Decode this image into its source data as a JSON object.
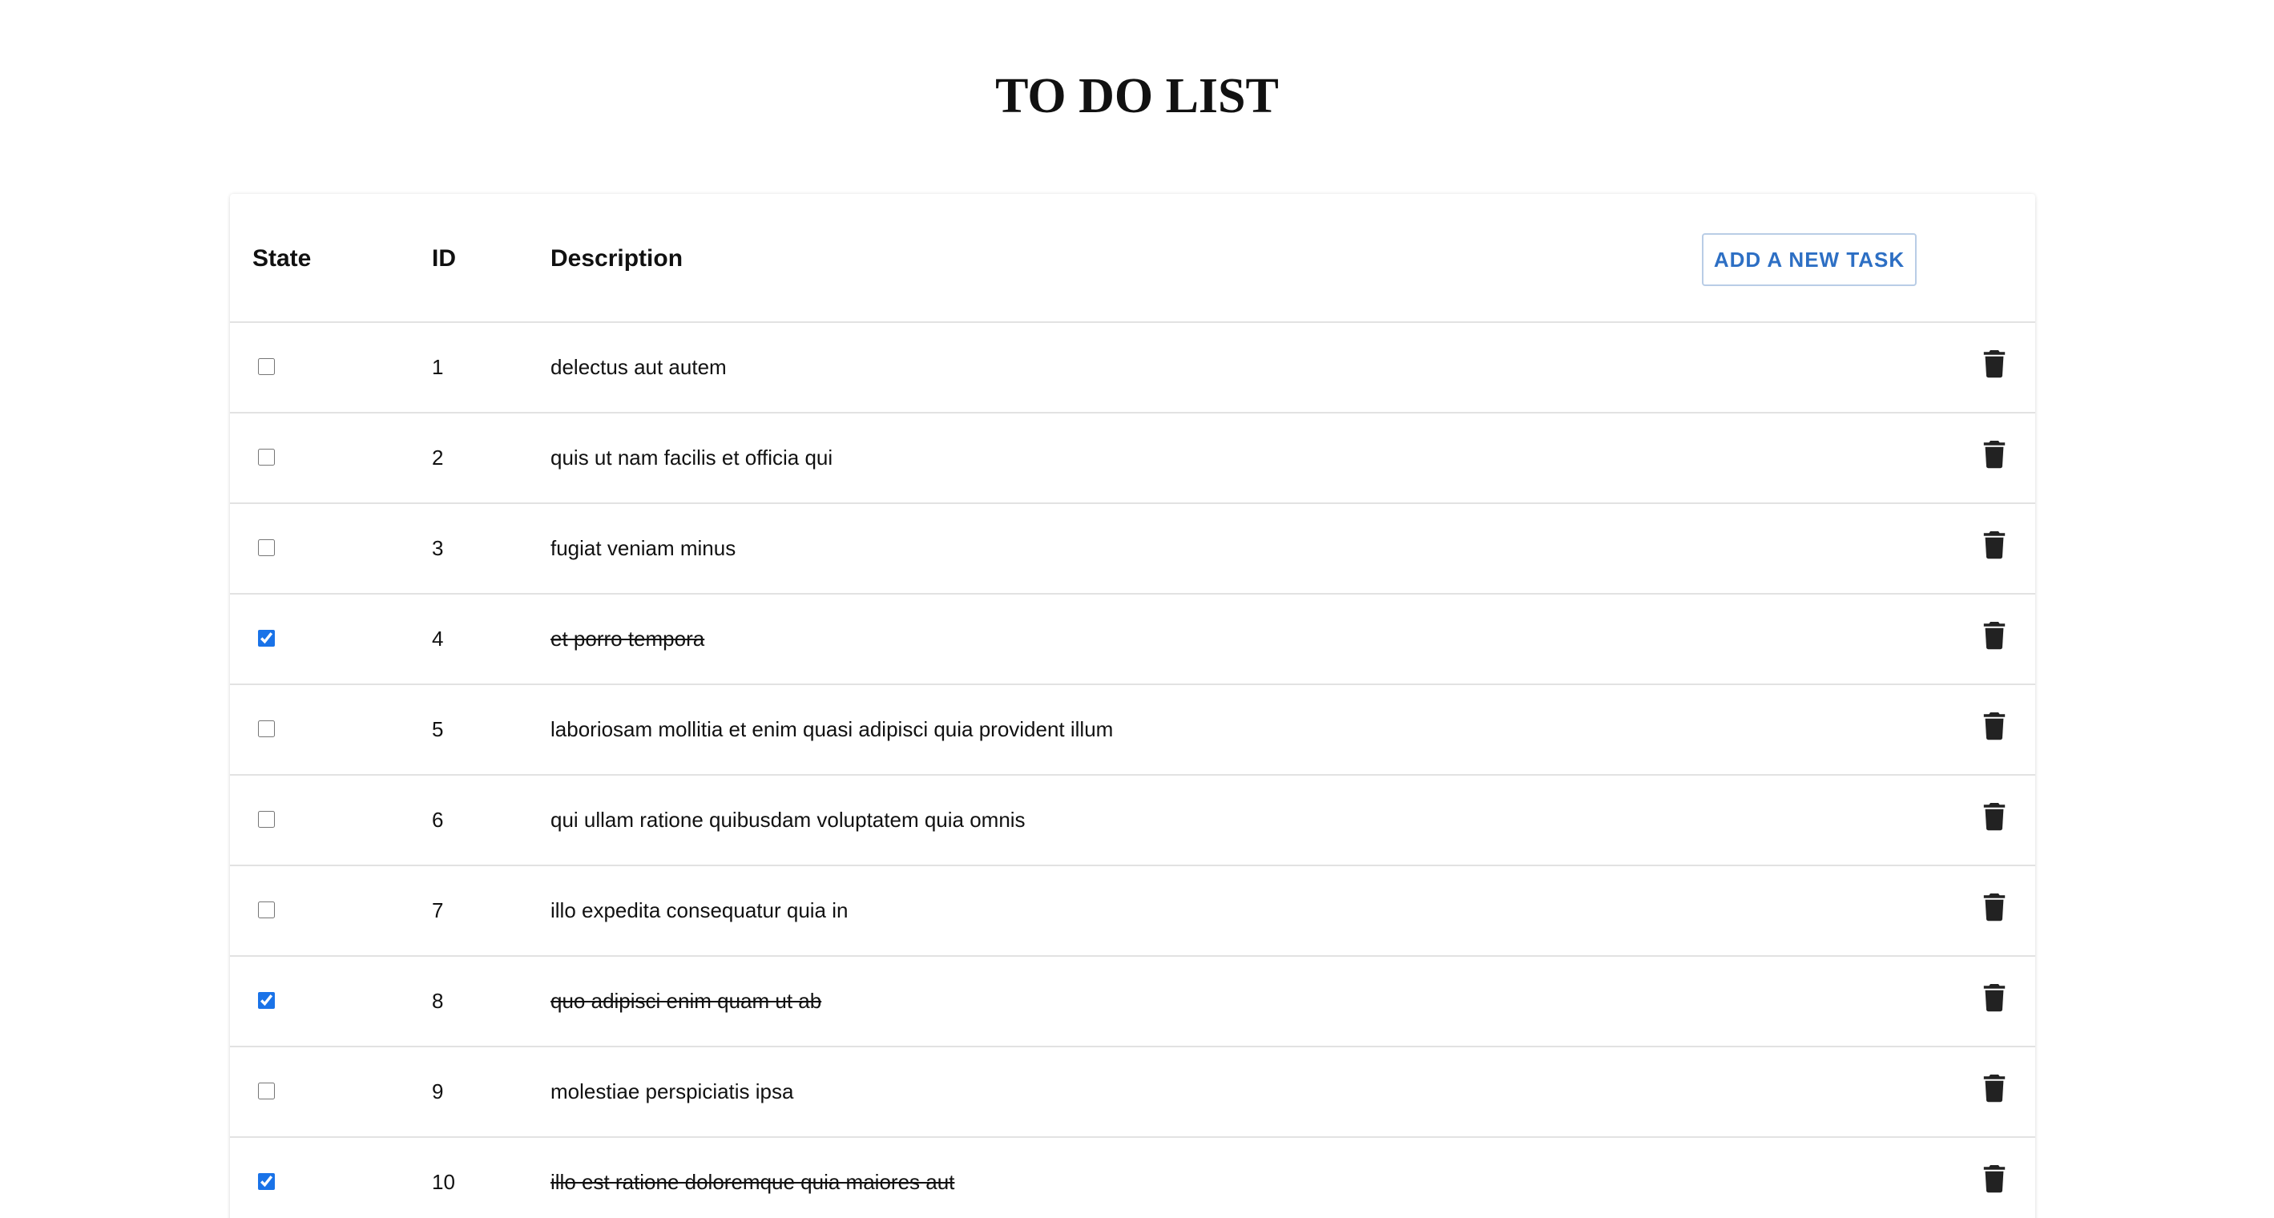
{
  "title": "TO DO LIST",
  "table": {
    "headers": {
      "state": "State",
      "id": "ID",
      "description": "Description"
    },
    "add_button_label": "ADD A NEW TASK",
    "rows": [
      {
        "id": "1",
        "description": "delectus aut autem",
        "done": false
      },
      {
        "id": "2",
        "description": "quis ut nam facilis et officia qui",
        "done": false
      },
      {
        "id": "3",
        "description": "fugiat veniam minus",
        "done": false
      },
      {
        "id": "4",
        "description": "et porro tempora",
        "done": true
      },
      {
        "id": "5",
        "description": "laboriosam mollitia et enim quasi adipisci quia provident illum",
        "done": false
      },
      {
        "id": "6",
        "description": "qui ullam ratione quibusdam voluptatem quia omnis",
        "done": false
      },
      {
        "id": "7",
        "description": "illo expedita consequatur quia in",
        "done": false
      },
      {
        "id": "8",
        "description": "quo adipisci enim quam ut ab",
        "done": true
      },
      {
        "id": "9",
        "description": "molestiae perspiciatis ipsa",
        "done": false
      },
      {
        "id": "10",
        "description": "illo est ratione doloremque quia maiores aut",
        "done": true
      }
    ]
  },
  "icons": {
    "delete": "trash-icon"
  },
  "colors": {
    "accent": "#1a73e8",
    "button_text": "#2d6fc4",
    "button_border": "#b9cde6",
    "divider": "#e2e2e2",
    "trash": "#222222"
  }
}
